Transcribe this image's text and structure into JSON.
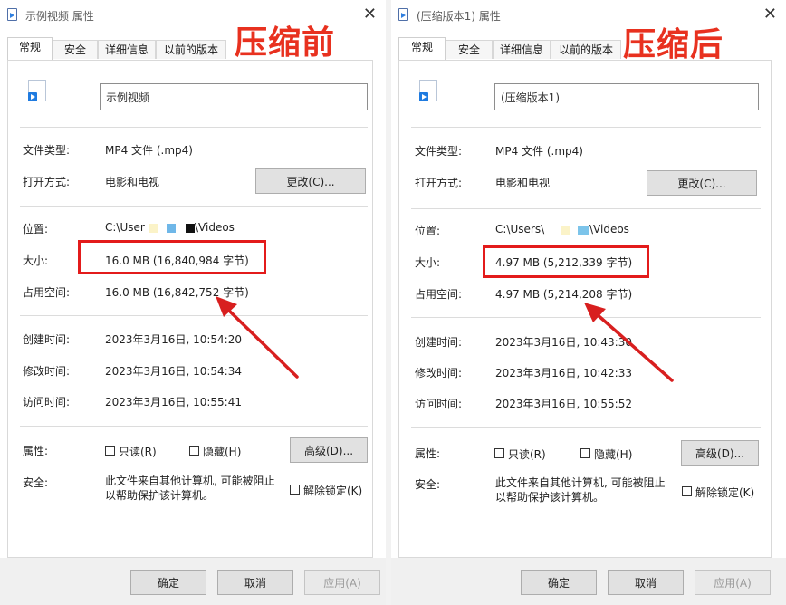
{
  "left": {
    "caption": "压缩前",
    "window_title": "示例视频 属性",
    "tabs": [
      "常规",
      "安全",
      "详细信息",
      "以前的版本"
    ],
    "filename": "示例视频",
    "file_type_label": "文件类型:",
    "file_type_value": "MP4 文件 (.mp4)",
    "open_with_label": "打开方式:",
    "open_with_value": "电影和电视",
    "change_button": "更改(C)...",
    "location_label": "位置:",
    "location_prefix": "C:\\User",
    "location_suffix": "\\Videos",
    "size_label": "大小:",
    "size_value": "16.0 MB (16,840,984 字节)",
    "disk_size_label": "占用空间:",
    "disk_size_value": "16.0 MB (16,842,752 字节)",
    "created_label": "创建时间:",
    "created_value": "2023年3月16日, 10:54:20",
    "modified_label": "修改时间:",
    "modified_value": "2023年3月16日, 10:54:34",
    "accessed_label": "访问时间:",
    "accessed_value": "2023年3月16日, 10:55:41",
    "attributes_label": "属性:",
    "readonly_label": "只读(R)",
    "hidden_label": "隐藏(H)",
    "advanced_button": "高级(D)...",
    "security_label": "安全:",
    "security_text_1": "此文件来自其他计算机, 可能被阻止",
    "security_text_2": "以帮助保护该计算机。",
    "unblock_label": "解除锁定(K)",
    "ok_button": "确定",
    "cancel_button": "取消",
    "apply_button": "应用(A)"
  },
  "right": {
    "caption": "压缩后",
    "window_title": "(压缩版本1) 属性",
    "tabs": [
      "常规",
      "安全",
      "详细信息",
      "以前的版本"
    ],
    "filename": "(压缩版本1)",
    "file_type_label": "文件类型:",
    "file_type_value": "MP4 文件 (.mp4)",
    "open_with_label": "打开方式:",
    "open_with_value": "电影和电视",
    "change_button": "更改(C)...",
    "location_label": "位置:",
    "location_prefix": "C:\\Users\\",
    "location_suffix": "\\Videos",
    "size_label": "大小:",
    "size_value": "4.97 MB (5,212,339 字节)",
    "disk_size_label": "占用空间:",
    "disk_size_value": "4.97 MB (5,214,208 字节)",
    "created_label": "创建时间:",
    "created_value": "2023年3月16日, 10:43:30",
    "modified_label": "修改时间:",
    "modified_value": "2023年3月16日, 10:42:33",
    "accessed_label": "访问时间:",
    "accessed_value": "2023年3月16日, 10:55:52",
    "attributes_label": "属性:",
    "readonly_label": "只读(R)",
    "hidden_label": "隐藏(H)",
    "advanced_button": "高级(D)...",
    "security_label": "安全:",
    "security_text_1": "此文件来自其他计算机, 可能被阻止",
    "security_text_2": "以帮助保护该计算机。",
    "unblock_label": "解除锁定(K)",
    "ok_button": "确定",
    "cancel_button": "取消",
    "apply_button": "应用(A)"
  },
  "colors": {
    "caption": "#e8311f",
    "highlight_box": "#e31b1b",
    "arrow": "#d81f1f",
    "file_icon": "#1f7be0"
  }
}
